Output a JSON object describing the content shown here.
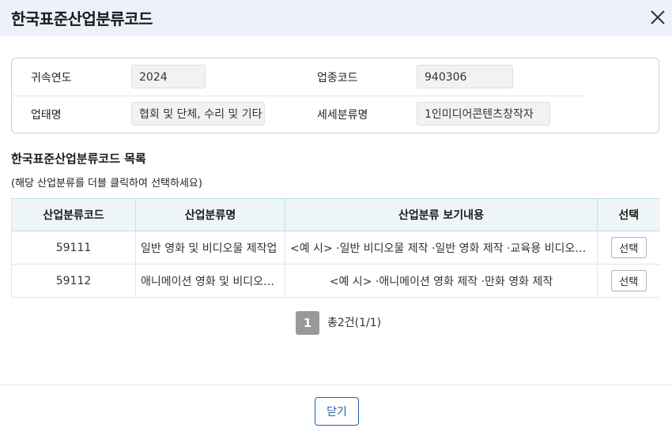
{
  "dialog": {
    "title": "한국표준산업분류코드",
    "close_icon": "close-icon",
    "close_button": "닫기"
  },
  "info": {
    "year_label": "귀속연도",
    "year_value": "2024",
    "industry_code_label": "업종코드",
    "industry_code_value": "940306",
    "business_type_label": "업태명",
    "business_type_value": "협회 및 단체, 수리 및 기타",
    "subclass_label": "세세분류명",
    "subclass_value": "1인미디어콘텐츠창작자"
  },
  "list": {
    "title": "한국표준산업분류코드 목록",
    "subtitle": "(해당 산업분류를 더블 클릭하여 선택하세요)",
    "columns": [
      "산업분류코드",
      "산업분류명",
      "산업분류 보기내용",
      "선택"
    ],
    "rows": [
      {
        "code": "59111",
        "name": "일반 영화 및 비디오물 제작업",
        "description": "<예 시> ·일반 비디오물 제작 ·일반 영화 제작 ·교육용 비디오물 제작",
        "select": "선택"
      },
      {
        "code": "59112",
        "name": "애니메이션 영화 및 비디오물 제작업",
        "description": "<예 시> ·애니메이션 영화 제작 ·만화 영화 제작",
        "select": "선택"
      }
    ]
  },
  "pagination": {
    "current_page": "1",
    "total_text": "총2건(1/1)"
  }
}
